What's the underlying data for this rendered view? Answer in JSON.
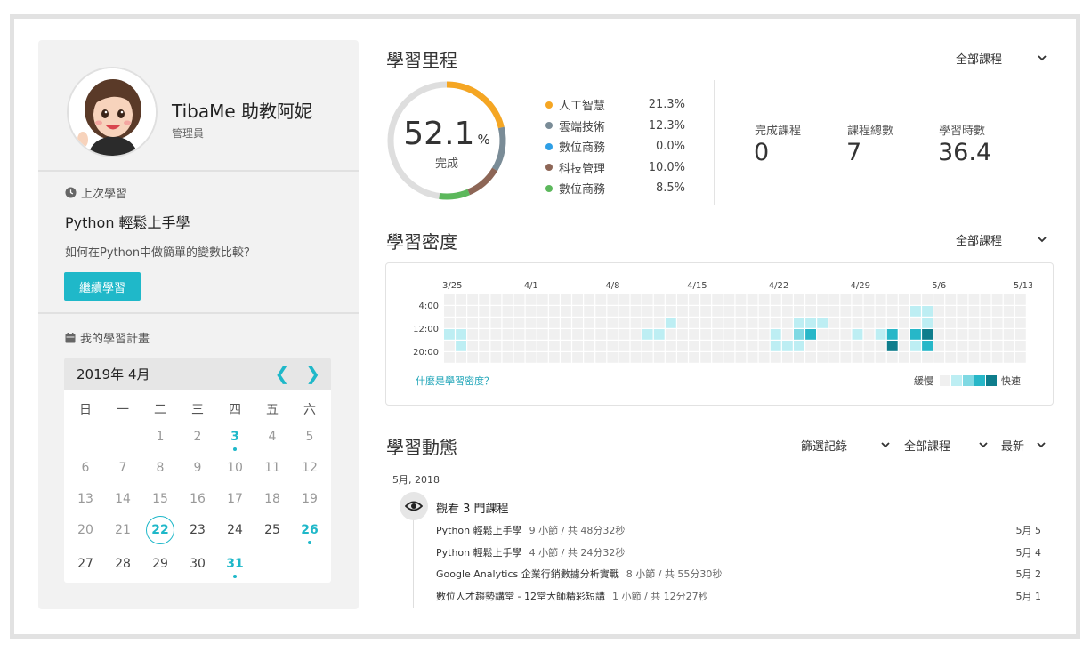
{
  "profile": {
    "name": "TibaMe 助教阿妮",
    "role": "管理員"
  },
  "last_learning": {
    "heading": "上次學習",
    "course": "Python 輕鬆上手學",
    "lesson": "如何在Python中做簡單的變數比較？",
    "button": "繼續學習"
  },
  "plan": {
    "heading": "我的學習計畫",
    "month_title": "2019年 4月",
    "prev_icon": "chevron-left-icon",
    "next_icon": "chevron-right-icon",
    "weekdays": [
      "日",
      "一",
      "二",
      "三",
      "四",
      "五",
      "六"
    ],
    "weeks": [
      [
        "",
        "",
        "1",
        "2",
        "3",
        "4",
        "5"
      ],
      [
        "6",
        "7",
        "8",
        "9",
        "10",
        "11",
        "12"
      ],
      [
        "13",
        "14",
        "15",
        "16",
        "17",
        "18",
        "19"
      ],
      [
        "20",
        "21",
        "22",
        "23",
        "24",
        "25",
        "26"
      ],
      [
        "27",
        "28",
        "29",
        "30",
        "31",
        "",
        ""
      ]
    ],
    "marked_days": [
      "3",
      "26",
      "31"
    ],
    "today": "22",
    "muted_days": [
      "1",
      "2",
      "4",
      "5",
      "6",
      "7",
      "8",
      "9",
      "10",
      "11",
      "12",
      "13",
      "14",
      "15",
      "16",
      "17",
      "18",
      "19",
      "20",
      "21"
    ]
  },
  "progress": {
    "title": "學習里程",
    "filter": "全部課程",
    "percent": "52.1",
    "percent_unit": "%",
    "percent_label": "完成",
    "categories": [
      {
        "name": "人工智慧",
        "value": "21.3%",
        "fraction": 0.213,
        "color": "#f5a623"
      },
      {
        "name": "雲端技術",
        "value": "12.3%",
        "fraction": 0.123,
        "color": "#7a8c97"
      },
      {
        "name": "數位商務",
        "value": "0.0%",
        "fraction": 0.0,
        "color": "#2e9fe6"
      },
      {
        "name": "科技管理",
        "value": "10.0%",
        "fraction": 0.1,
        "color": "#8d6656"
      },
      {
        "name": "數位商務",
        "value": "8.5%",
        "fraction": 0.085,
        "color": "#5cb85c"
      }
    ],
    "ring_track_color": "#dedede",
    "stats": [
      {
        "label": "完成課程",
        "value": "0"
      },
      {
        "label": "課程總數",
        "value": "7"
      },
      {
        "label": "學習時數",
        "value": "36.4"
      }
    ]
  },
  "density": {
    "title": "學習密度",
    "filter": "全部課程",
    "date_labels": [
      "3/25",
      "4/1",
      "4/8",
      "4/15",
      "4/22",
      "4/29",
      "5/6",
      "5/13"
    ],
    "time_labels": [
      "4:00",
      "12:00",
      "20:00"
    ],
    "help_link": "什麼是學習密度？",
    "legend_slow": "緩慢",
    "legend_fast": "快速",
    "scale_colors": [
      "#f0f0f0",
      "#bdeef3",
      "#7fd9e3",
      "#27b7c8",
      "#0e7d8c"
    ]
  },
  "activity": {
    "title": "學習動態",
    "filter_records": "篩選記錄",
    "filter_course": "全部課程",
    "sort": "最新",
    "group_date": "5月, 2018",
    "group_title": "觀看 3 門課程",
    "items": [
      {
        "course": "Python 輕鬆上手學",
        "meta": "9 小節 / 共 48分32秒",
        "date": "5月 5"
      },
      {
        "course": "Python 輕鬆上手學",
        "meta": "4 小節 / 共 24分32秒",
        "date": "5月 4"
      },
      {
        "course": "Google Analytics 企業行銷數據分析實戰",
        "meta": "8 小節 / 共 55分30秒",
        "date": "5月 2"
      },
      {
        "course": "數位人才趨勢講堂 - 12堂大師精彩短講",
        "meta": "1 小節 / 共 12分27秒",
        "date": "5月 1"
      }
    ]
  }
}
